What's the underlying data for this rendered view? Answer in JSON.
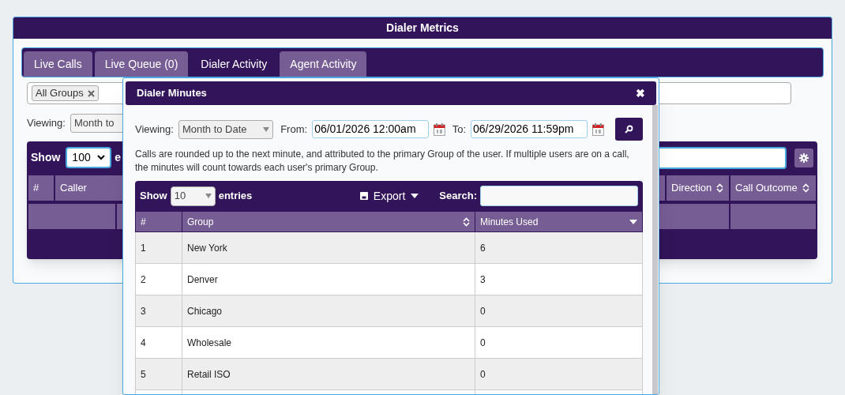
{
  "window": {
    "title": "Dialer Metrics"
  },
  "tabs": [
    {
      "label": "Live Calls",
      "selected": false
    },
    {
      "label": "Live Queue (0)",
      "selected": false
    },
    {
      "label": "Dialer Activity",
      "selected": true
    },
    {
      "label": "Agent Activity",
      "selected": false
    }
  ],
  "group_filter": {
    "tags": [
      "All Groups"
    ]
  },
  "viewing": {
    "label": "Viewing:",
    "value": "Month to"
  },
  "calls_table": {
    "show_label": "Show",
    "page_size": "100",
    "entries_label": "e",
    "columns": [
      {
        "label": "#",
        "sortable": false
      },
      {
        "label": "Caller",
        "sortable": false
      },
      {
        "label": "Direction",
        "sortable": true
      },
      {
        "label": "Call Outcome",
        "sortable": true
      }
    ]
  },
  "dialog": {
    "title": "Dialer Minutes",
    "close": "✖",
    "viewing_label": "Viewing:",
    "viewing_value": "Month to Date",
    "from_label": "From:",
    "from_value": "06/01/2026 12:00am",
    "to_label": "To:",
    "to_value": "06/29/2026 11:59pm",
    "note": "Calls are rounded up to the next minute, and attributed to the primary Group of the user. If multiple users are on a call, the minutes will count towards each user's primary Group.",
    "table": {
      "show_label": "Show",
      "page_size": "10",
      "entries_label": "entries",
      "export_label": "Export",
      "search_label": "Search:",
      "columns": [
        {
          "label": "#",
          "sortable": false
        },
        {
          "label": "Group",
          "sortable": true,
          "sorted_descending": false
        },
        {
          "label": "Minutes Used",
          "sortable": true,
          "sorted_descending": true
        }
      ],
      "rows": [
        [
          "1",
          "New York",
          "6"
        ],
        [
          "2",
          "Denver",
          "3"
        ],
        [
          "3",
          "Chicago",
          "0"
        ],
        [
          "4",
          "Wholesale",
          "0"
        ],
        [
          "5",
          "Retail ISO",
          "0"
        ]
      ]
    }
  }
}
